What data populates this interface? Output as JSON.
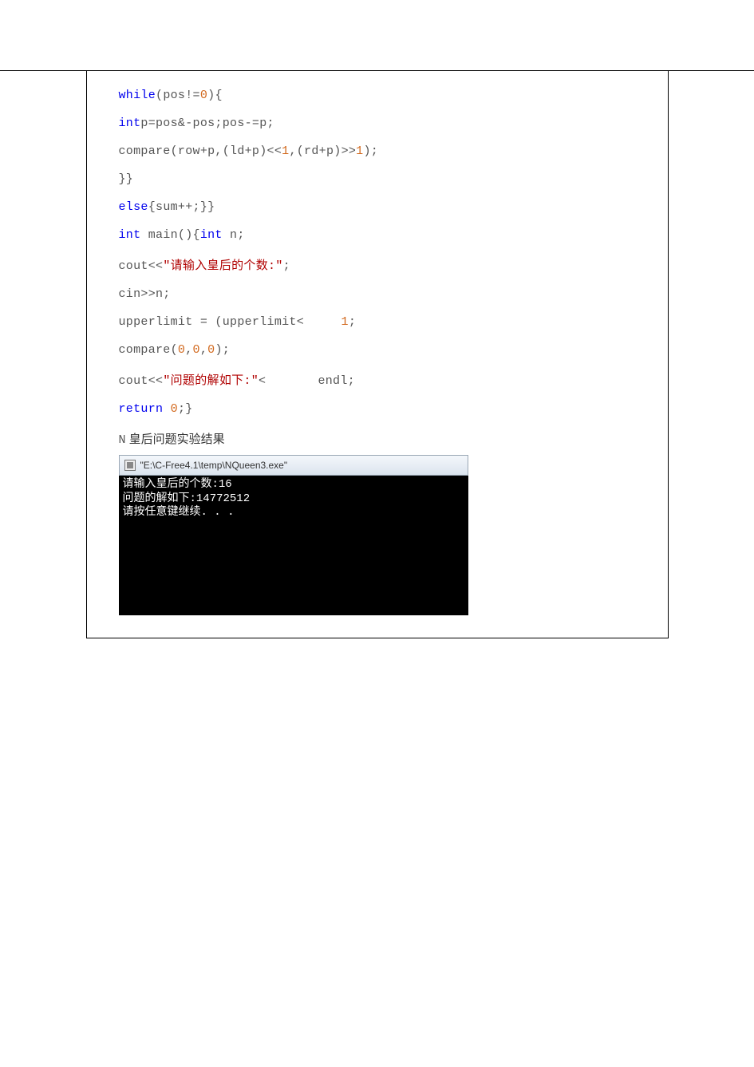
{
  "code": {
    "line1_kw": "while",
    "line1_rest": "(pos!=",
    "line1_num": "0",
    "line1_tail": "){",
    "line2_kw": "int",
    "line2_rest": "p=pos&-pos;pos-=p;",
    "line3_a": "compare(row+p,(ld+p)<<",
    "line3_n1": "1",
    "line3_b": ",(rd+p)>>",
    "line3_n2": "1",
    "line3_c": ");",
    "line4": "}}",
    "line5_kw": "else",
    "line5_rest": "{sum++;}}",
    "line6_kw1": "int",
    "line6_mid": " main(){",
    "line6_kw2": "int",
    "line6_tail": " n;",
    "line7_a": "cout<<",
    "line7_str": "\"请输入皇后的个数:\"",
    "line7_b": ";",
    "line8": "cin>>n;",
    "line9_a": "upperlimit = (upperlimit<     ",
    "line9_n": "1",
    "line9_b": ";",
    "line10_a": "compare(",
    "line10_n1": "0",
    "line10_b": ",",
    "line10_n2": "0",
    "line10_c": ",",
    "line10_n3": "0",
    "line10_d": ");",
    "line11_a": "cout<<",
    "line11_str": "\"问题的解如下:\"",
    "line11_b": "<       endl;",
    "line12_kw": "return",
    "line12_sp": " ",
    "line12_n": "0",
    "line12_b": ";}"
  },
  "label": {
    "prefix": "N",
    "text": " 皇后问题实验结果"
  },
  "console": {
    "title": "\"E:\\C-Free4.1\\temp\\NQueen3.exe\"",
    "line1": "请输入皇后的个数:16",
    "line2": "问题的解如下:14772512",
    "line3": "请按任意键继续. . ."
  }
}
